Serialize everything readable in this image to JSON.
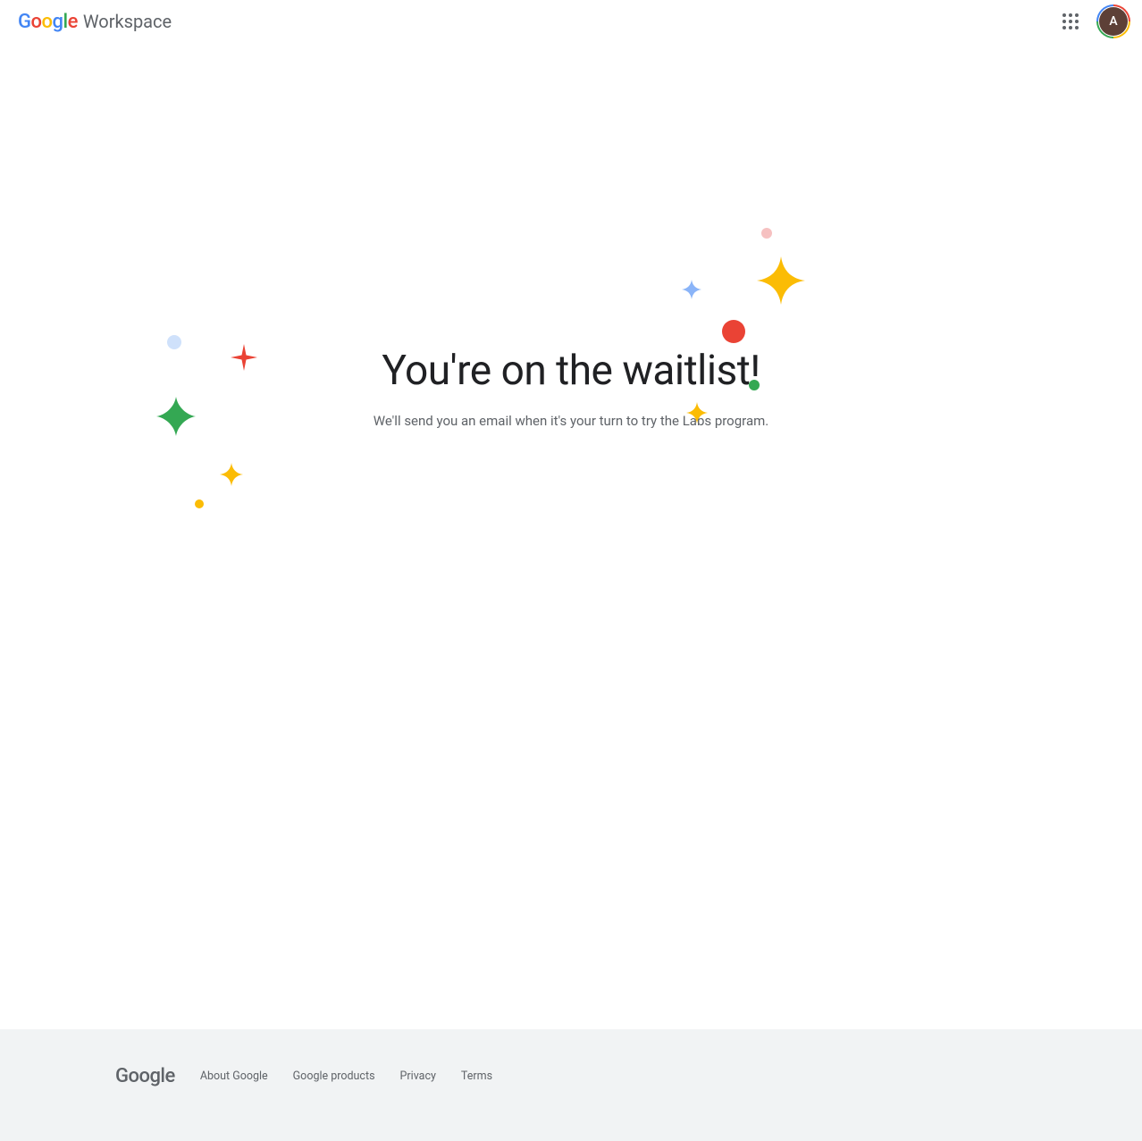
{
  "header": {
    "product_name": "Workspace",
    "avatar_initial": "A"
  },
  "hero": {
    "title": "You're on the waitlist!",
    "subtitle": "We'll send you an email when it's your turn to try the Labs program."
  },
  "footer": {
    "brand": "Google",
    "links": [
      {
        "label": "About Google"
      },
      {
        "label": "Google products"
      },
      {
        "label": "Privacy"
      },
      {
        "label": "Terms"
      }
    ]
  },
  "colors": {
    "red": "#EA4335",
    "yellow": "#FBBC05",
    "green": "#34A853",
    "blue": "#4285F4",
    "lightblue": "#AECBFA",
    "pink": "#F6C1C1",
    "lightblue2": "#CFE1FB"
  }
}
